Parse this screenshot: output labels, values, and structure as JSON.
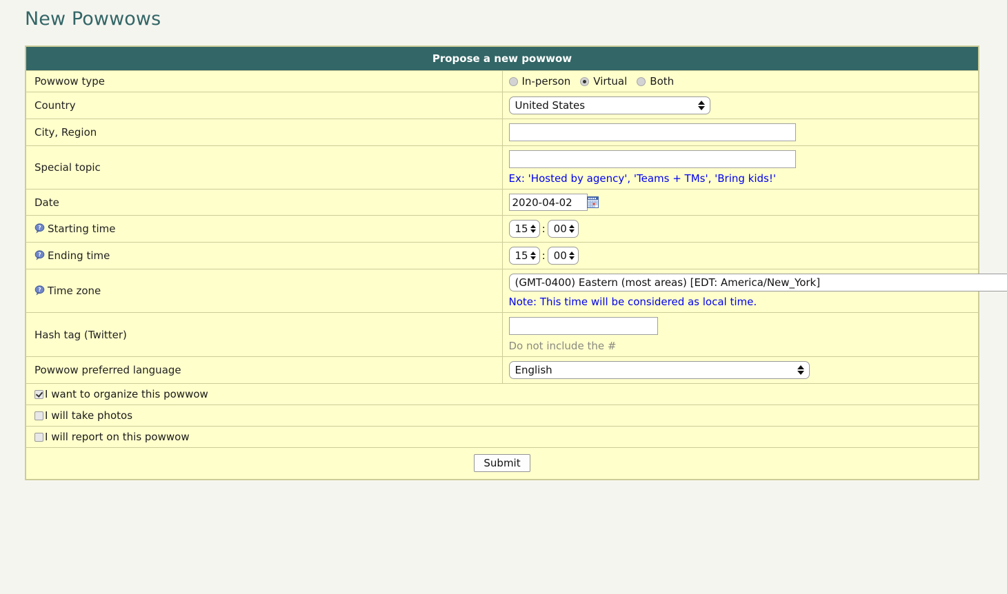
{
  "page": {
    "title": "New Powwows",
    "title_color": "#336666"
  },
  "theme": {
    "header_bg": "#336666",
    "table_bg": "#ffffcc",
    "table_border": "#cccc99",
    "page_bg": "#f5f5f0",
    "link_blue": "#0000ee",
    "hint_gray": "#8a8a80"
  },
  "form": {
    "header": "Propose a new powwow",
    "rows": {
      "powwow_type": {
        "label": "Powwow type",
        "options": [
          {
            "label": "In-person",
            "selected": false
          },
          {
            "label": "Virtual",
            "selected": true
          },
          {
            "label": "Both",
            "selected": false
          }
        ]
      },
      "country": {
        "label": "Country",
        "value": "United States",
        "options": [
          "United States"
        ]
      },
      "city_region": {
        "label": "City, Region",
        "value": "",
        "placeholder": ""
      },
      "special_topic": {
        "label": "Special topic",
        "value": "",
        "placeholder": "",
        "hint": "Ex: 'Hosted by agency', 'Teams + TMs', 'Bring kids!'"
      },
      "date": {
        "label": "Date",
        "value": "2020-04-02",
        "icon": "calendar-icon"
      },
      "starting_time": {
        "label": "Starting time",
        "help_icon": "help-question-icon",
        "hour": "15",
        "minute": "00",
        "separator": ":"
      },
      "ending_time": {
        "label": "Ending time",
        "help_icon": "help-question-icon",
        "hour": "15",
        "minute": "00",
        "separator": ":"
      },
      "time_zone": {
        "label": "Time zone",
        "help_icon": "help-question-icon",
        "value": "(GMT-0400) Eastern (most areas) [EDT: America/New_York]",
        "options": [
          "(GMT-0400) Eastern (most areas) [EDT: America/New_York]"
        ],
        "note": "Note: This time will be considered as local time."
      },
      "hash_tag": {
        "label": "Hash tag (Twitter)",
        "value": "",
        "placeholder": "",
        "hint": "Do not include the #"
      },
      "language": {
        "label": "Powwow preferred language",
        "value": "English",
        "options": [
          "English"
        ]
      }
    },
    "checkboxes": [
      {
        "label": "I want to organize this powwow",
        "checked": true
      },
      {
        "label": "I will take photos",
        "checked": false
      },
      {
        "label": "I will report on this powwow",
        "checked": false
      }
    ],
    "submit_label": "Submit"
  }
}
